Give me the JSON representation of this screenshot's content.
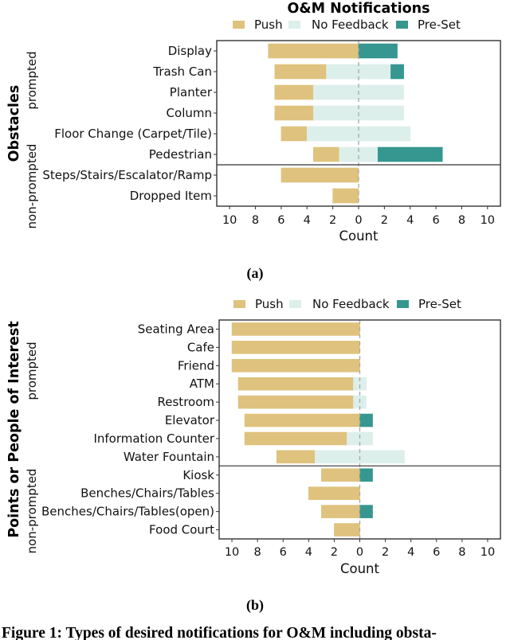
{
  "figure": {
    "caption": "Figure 1: Types of desired notifications for O&M including obsta-"
  },
  "chart_data": [
    {
      "type": "bar",
      "orientation": "horizontal-diverging",
      "panel_label": "(a)",
      "title": "O&M Notifications",
      "group_label": "Obstacles",
      "legend": [
        "Push",
        "No Feedback",
        "Pre-Set"
      ],
      "legend_placement": "top-center",
      "colors": {
        "Push": "#dfc27d",
        "No Feedback": "#dcefeb",
        "Pre-Set": "#35978f"
      },
      "sections": [
        {
          "label": "prompted",
          "count": 6
        },
        {
          "label": "non-prompted",
          "count": 2
        }
      ],
      "categories": [
        "Display",
        "Trash Can",
        "Planter",
        "Column",
        "Floor Change (Carpet/Tile)",
        "Pedestrian",
        "Steps/Stairs/Escalator/Ramp",
        "Dropped Item"
      ],
      "series": [
        {
          "name": "Push",
          "values": [
            7,
            4,
            3,
            3,
            2,
            2,
            6,
            2
          ]
        },
        {
          "name": "No Feedback",
          "values": [
            0,
            5,
            7,
            7,
            8,
            3,
            0,
            0
          ]
        },
        {
          "name": "Pre-Set",
          "values": [
            3,
            1,
            0,
            0,
            0,
            5,
            0,
            0
          ]
        }
      ],
      "layout_note": "Push extends left of center, No Feedback centered on zero, Pre-Set extends right",
      "xlabel": "Count",
      "ylabel": "",
      "xlim": [
        -11,
        11
      ],
      "xticks": [
        -10,
        -8,
        -6,
        -4,
        -2,
        0,
        2,
        4,
        6,
        8,
        10
      ],
      "xtick_labels": [
        "10",
        "8",
        "6",
        "4",
        "2",
        "0",
        "2",
        "4",
        "6",
        "8",
        "10"
      ],
      "zero_line": "dashed",
      "grid": false
    },
    {
      "type": "bar",
      "orientation": "horizontal-diverging",
      "panel_label": "(b)",
      "title": "",
      "group_label": "Points or People of Interest",
      "legend": [
        "Push",
        "No Feedback",
        "Pre-Set"
      ],
      "legend_placement": "top-center",
      "colors": {
        "Push": "#dfc27d",
        "No Feedback": "#dcefeb",
        "Pre-Set": "#35978f"
      },
      "sections": [
        {
          "label": "prompted",
          "count": 8
        },
        {
          "label": "non-prompted",
          "count": 4
        }
      ],
      "categories": [
        "Seating Area",
        "Cafe",
        "Friend",
        "ATM",
        "Restroom",
        "Elevator",
        "Information Counter",
        "Water Fountain",
        "Kiosk",
        "Benches/Chairs/Tables",
        "Benches/Chairs/Tables(open)",
        "Food Court"
      ],
      "series": [
        {
          "name": "Push",
          "values": [
            10,
            10,
            10,
            9,
            9,
            9,
            8,
            3,
            3,
            4,
            3,
            2
          ]
        },
        {
          "name": "No Feedback",
          "values": [
            0,
            0,
            0,
            1,
            1,
            0,
            2,
            7,
            0,
            0,
            0,
            0
          ]
        },
        {
          "name": "Pre-Set",
          "values": [
            0,
            0,
            0,
            0,
            0,
            1,
            0,
            0,
            1,
            0,
            1,
            0
          ]
        }
      ],
      "layout_note": "Push extends left of center, No Feedback centered on zero, Pre-Set extends right",
      "xlabel": "Count",
      "ylabel": "",
      "xlim": [
        -11,
        11
      ],
      "xticks": [
        -10,
        -8,
        -6,
        -4,
        -2,
        0,
        2,
        4,
        6,
        8,
        10
      ],
      "xtick_labels": [
        "10",
        "8",
        "6",
        "4",
        "2",
        "0",
        "2",
        "4",
        "6",
        "8",
        "10"
      ],
      "zero_line": "dashed",
      "grid": false
    }
  ]
}
